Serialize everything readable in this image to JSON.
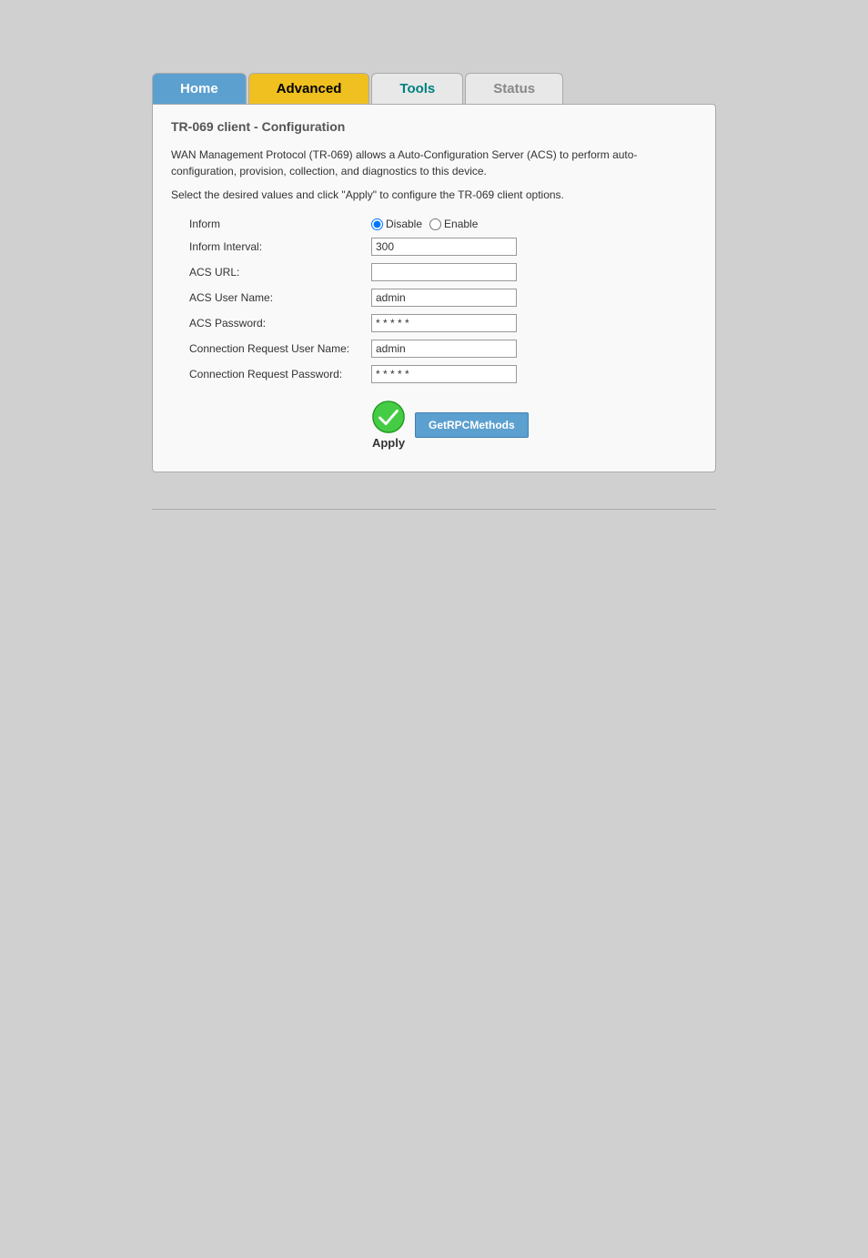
{
  "nav": {
    "home_label": "Home",
    "advanced_label": "Advanced",
    "tools_label": "Tools",
    "status_label": "Status"
  },
  "page": {
    "title": "TR-069 client - Configuration",
    "description": "WAN Management Protocol (TR-069) allows a Auto-Configuration Server (ACS) to perform auto-configuration, provision, collection, and diagnostics to this device.",
    "instruction": "Select the desired values and click \"Apply\" to configure the TR-069 client options."
  },
  "form": {
    "inform_label": "Inform",
    "inform_disable": "Disable",
    "inform_enable": "Enable",
    "interval_label": "Inform Interval:",
    "interval_value": "300",
    "acs_url_label": "ACS URL:",
    "acs_url_value": "",
    "acs_user_label": "ACS User Name:",
    "acs_user_value": "admin",
    "acs_pass_label": "ACS Password:",
    "acs_pass_value": "* * * * *",
    "conn_user_label": "Connection Request User Name:",
    "conn_user_value": "admin",
    "conn_pass_label": "Connection Request Password:",
    "conn_pass_value": "* * * * *"
  },
  "buttons": {
    "apply_label": "Apply",
    "getrpc_label": "GetRPCMethods"
  }
}
